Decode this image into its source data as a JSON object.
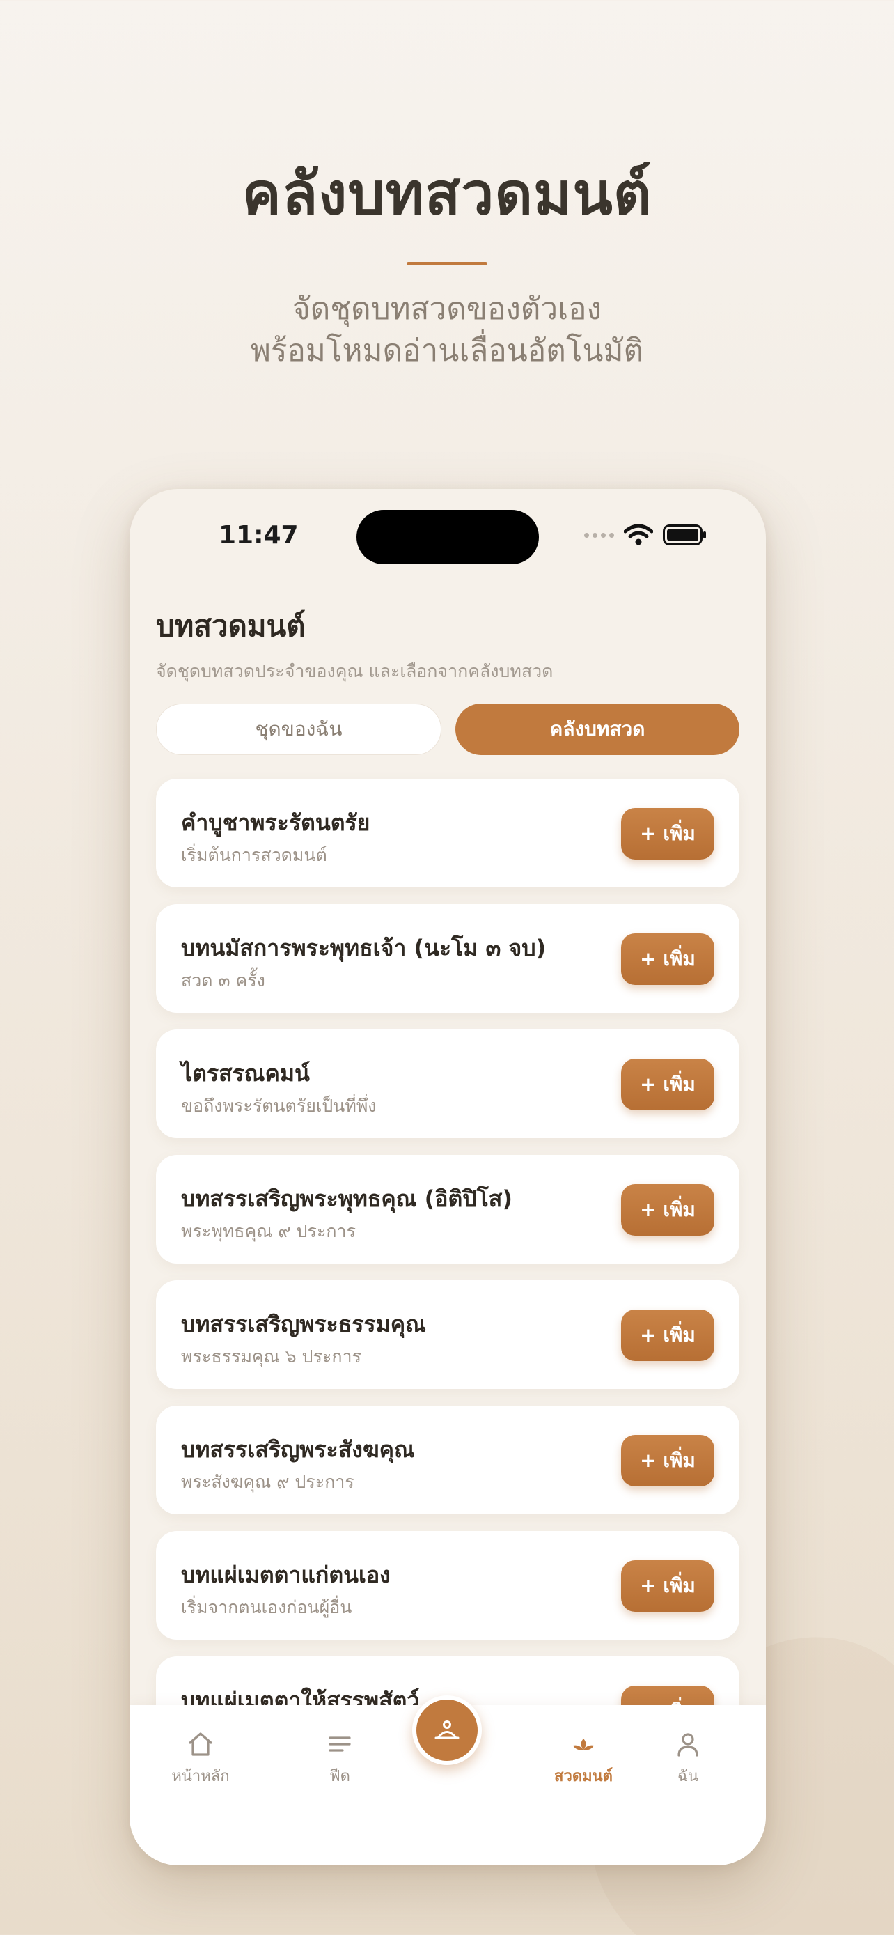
{
  "hero": {
    "title": "คลังบทสวดมนต์",
    "subtitle_line1": "จัดชุดบทสวดของตัวเอง",
    "subtitle_line2": "พร้อมโหมดอ่านเลื่อนอัตโนมัติ"
  },
  "status": {
    "time": "11:47"
  },
  "screen": {
    "title": "บทสวดมนต์",
    "subtitle": "จัดชุดบทสวดประจำของคุณ และเลือกจากคลังบทสวด"
  },
  "segments": {
    "mine": "ชุดของฉัน",
    "library": "คลังบทสวด",
    "selected": "library"
  },
  "add_label": "+ เพิ่ม",
  "prayers": [
    {
      "title": "คำบูชาพระรัตนตรัย",
      "subtitle": "เริ่มต้นการสวดมนต์"
    },
    {
      "title": "บทนมัสการพระพุทธเจ้า (นะโม ๓ จบ)",
      "subtitle": "สวด ๓ ครั้ง"
    },
    {
      "title": "ไตรสรณคมน์",
      "subtitle": "ขอถึงพระรัตนตรัยเป็นที่พึ่ง"
    },
    {
      "title": "บทสรรเสริญพระพุทธคุณ (อิติปิโส)",
      "subtitle": "พระพุทธคุณ ๙ ประการ"
    },
    {
      "title": "บทสรรเสริญพระธรรมคุณ",
      "subtitle": "พระธรรมคุณ ๖ ประการ"
    },
    {
      "title": "บทสรรเสริญพระสังฆคุณ",
      "subtitle": "พระสังฆคุณ ๙ ประการ"
    },
    {
      "title": "บทแผ่เมตตาแก่ตนเอง",
      "subtitle": "เริ่มจากตนเองก่อนผู้อื่น"
    },
    {
      "title": "บทแผ่เมตตาให้สรรพสัตว์",
      "subtitle": ""
    }
  ],
  "tabs": {
    "home": "หน้าหลัก",
    "feed": "ฟีด",
    "prayer": "สวดมนต์",
    "me": "ฉัน"
  },
  "colors": {
    "accent": "#c17a3e",
    "text": "#2f2922",
    "muted": "#9c9288"
  }
}
